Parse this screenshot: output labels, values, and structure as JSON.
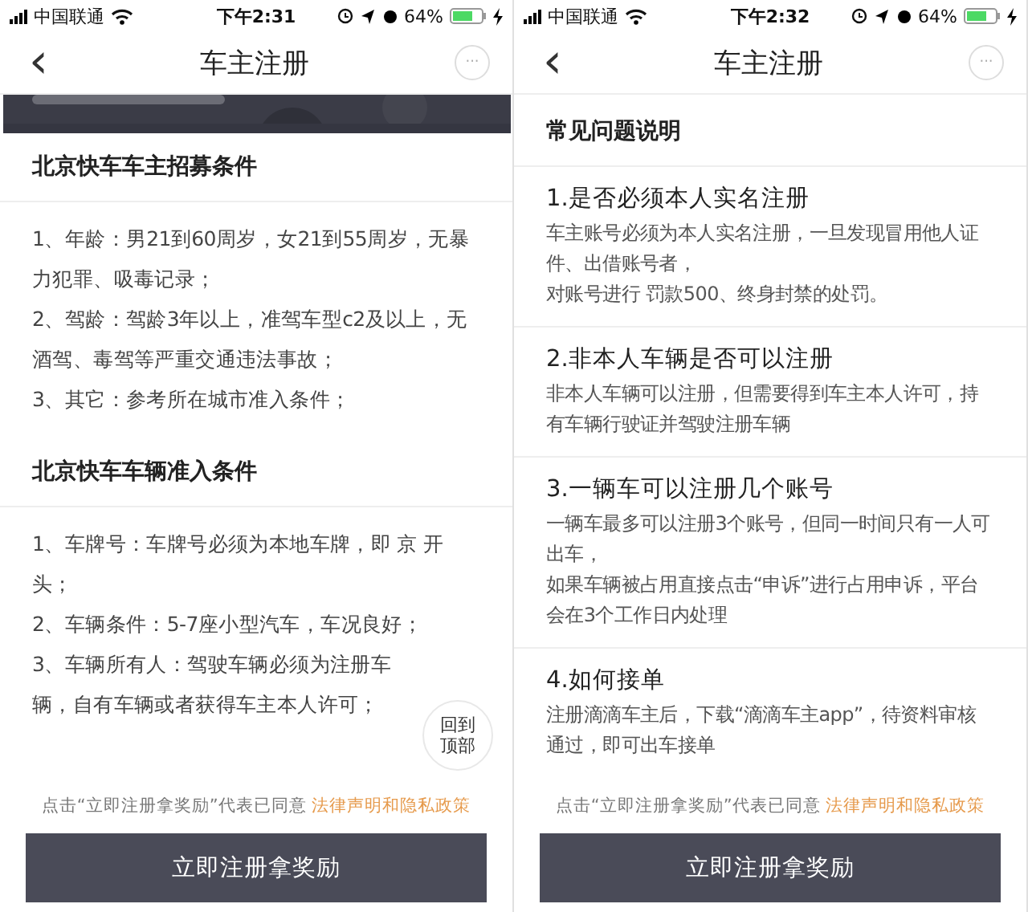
{
  "screens": [
    {
      "status_bar": {
        "carrier": "中国联通",
        "time": "下午2:31",
        "battery": "64%"
      },
      "nav": {
        "back": "‹",
        "title": "车主注册",
        "more": "···"
      },
      "blocks": [
        {
          "kind": "picture"
        },
        {
          "kind": "section",
          "heading": "北京快车车主招募条件",
          "items": [
            "1、年龄：男21到60周岁，女21到55周岁，无暴力犯罪、吸毒记录；",
            "2、驾龄：驾龄3年以上，准驾车型c2及以上，无酒驾、毒驾等严重交通违法事故；",
            "3、其它：参考所在城市准入条件；"
          ]
        },
        {
          "kind": "section",
          "heading": "北京快车车辆准入条件",
          "items": [
            "1、车牌号：车牌号必须为本地车牌，即 京 开头；",
            "2、车辆条件：5-7座小型汽车，车况良好；",
            "3、车辆所有人：驾驶车辆必须为注册车辆，自有车辆或者获得车主本人许可；"
          ]
        }
      ],
      "back_to_top": "回到顶部",
      "footer": {
        "note": "点击“立即注册拿奖励”代表已同意",
        "link": "法律声明和隐私政策",
        "button": "立即注册拿奖励"
      }
    },
    {
      "status_bar": {
        "carrier": "中国联通",
        "time": "下午2:32",
        "battery": "64%"
      },
      "nav": {
        "back": "‹",
        "title": "车主注册",
        "more": "···"
      },
      "blocks": [
        {
          "kind": "title",
          "text": "常见问题说明"
        },
        {
          "kind": "faq",
          "question": "1.是否必须本人实名注册",
          "answers": [
            "车主账号必须为本人实名注册，一旦发现冒用他人证件、出借账号者，",
            "对账号进行 罚款500、终身封禁的处罚。"
          ]
        },
        {
          "kind": "faq",
          "question": "2.非本人车辆是否可以注册",
          "answers": [
            "非本人车辆可以注册，但需要得到车主本人许可，持有车辆行驶证并驾驶注册车辆"
          ]
        },
        {
          "kind": "faq",
          "question": "3.一辆车可以注册几个账号",
          "answers": [
            "一辆车最多可以注册3个账号，但同一时间只有一人可出车，",
            "如果车辆被占用直接点击“申诉”进行占用申诉，平台会在3个工作日内处理"
          ]
        },
        {
          "kind": "faq",
          "question": "4.如何接单",
          "answers": [
            "注册滴滴车主后，下载“滴滴车主app”，待资料审核通过，即可出车接单"
          ]
        }
      ],
      "footer": {
        "note": "点击“立即注册拿奖励”代表已同意",
        "link": "法律声明和隐私政策",
        "button": "立即注册拿奖励"
      }
    }
  ]
}
